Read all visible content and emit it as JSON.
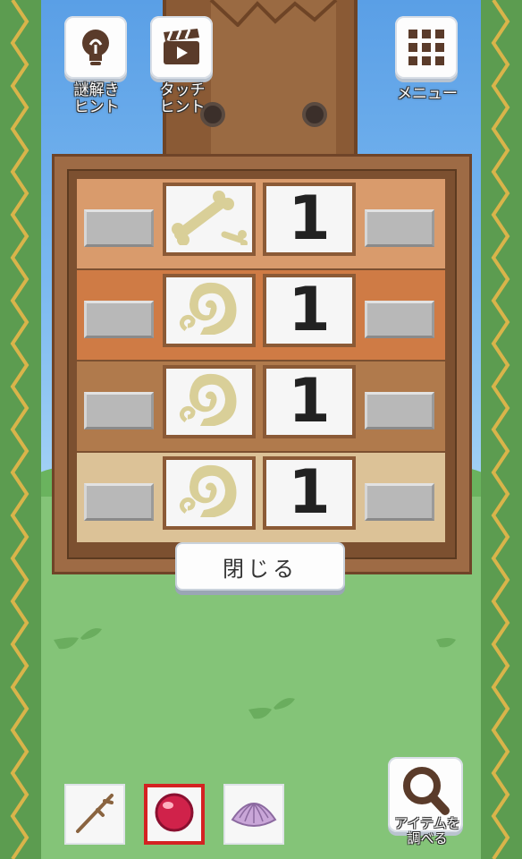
{
  "top_buttons": {
    "hint": {
      "label": "謎解き\nヒント",
      "icon": "lightbulb-icon"
    },
    "touch_hint": {
      "label": "タッチ\nヒント",
      "icon": "clapperboard-icon"
    },
    "menu": {
      "label": "メニュー",
      "icon": "grid-icon"
    }
  },
  "puzzle": {
    "rows": [
      {
        "symbol": "bone-icon",
        "number": "1",
        "color": "#d99b6c"
      },
      {
        "symbol": "ammonite-icon",
        "number": "1",
        "color": "#cf7b45"
      },
      {
        "symbol": "ammonite-icon",
        "number": "1",
        "color": "#b07a4c"
      },
      {
        "symbol": "ammonite-icon",
        "number": "1",
        "color": "#dcc297"
      }
    ],
    "close_label": "閉じる"
  },
  "inventory": {
    "items": [
      {
        "name": "stick-icon",
        "selected": false
      },
      {
        "name": "red-orb-icon",
        "selected": true
      },
      {
        "name": "shell-icon",
        "selected": false
      }
    ],
    "inspect_label": "アイテムを\n調べる"
  },
  "colors": {
    "sky": "#7ab8f0",
    "grass": "#84c478",
    "frame": "#9e6b45",
    "selected_border": "#d42222",
    "fossil": "#d9cf98"
  }
}
